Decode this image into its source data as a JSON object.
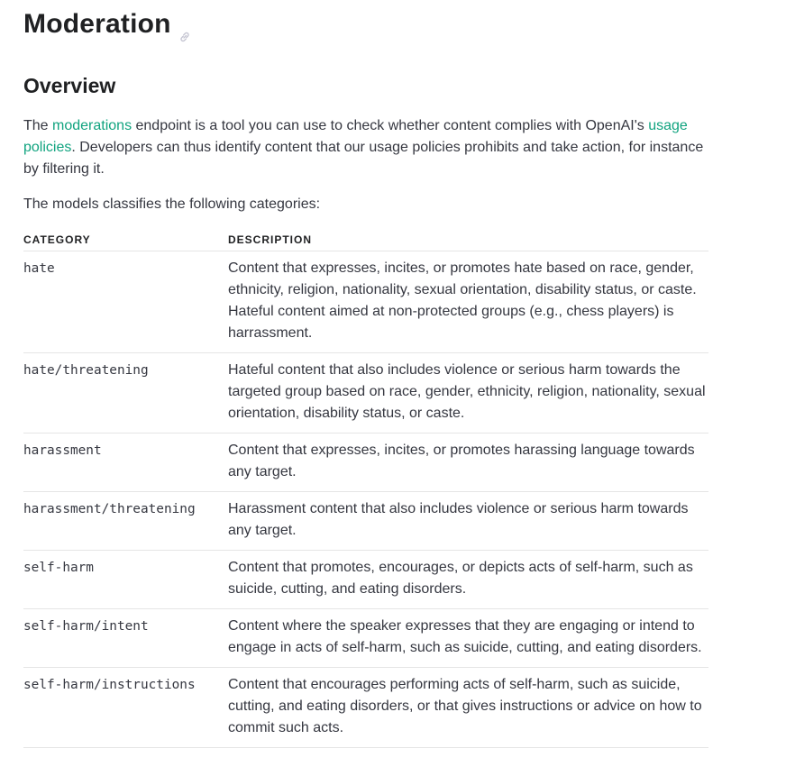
{
  "heading": {
    "title": "Moderation",
    "anchor_icon": "link-icon"
  },
  "overview": {
    "heading": "Overview",
    "intro_prefix": "The ",
    "moderations_link": "moderations",
    "intro_middle": " endpoint is a tool you can use to check whether content complies with OpenAI's ",
    "usage_link": "usage policies",
    "intro_suffix": ". Developers can thus identify content that our usage policies prohibits and take action, for instance by filtering it.",
    "lead": "The models classifies the following categories:"
  },
  "colors": {
    "link": "#10a37f",
    "text": "#353740",
    "heading": "#202123",
    "rule": "#e5e5e5"
  },
  "table": {
    "headers": {
      "category": "CATEGORY",
      "description": "DESCRIPTION"
    },
    "rows": [
      {
        "category": "hate",
        "description": "Content that expresses, incites, or promotes hate based on race, gender, ethnicity, religion, nationality, sexual orientation, disability status, or caste. Hateful content aimed at non-protected groups (e.g., chess players) is harrassment."
      },
      {
        "category": "hate/threatening",
        "description": "Hateful content that also includes violence or serious harm towards the targeted group based on race, gender, ethnicity, religion, nationality, sexual orientation, disability status, or caste."
      },
      {
        "category": "harassment",
        "description": "Content that expresses, incites, or promotes harassing language towards any target."
      },
      {
        "category": "harassment/threatening",
        "description": "Harassment content that also includes violence or serious harm towards any target."
      },
      {
        "category": "self-harm",
        "description": "Content that promotes, encourages, or depicts acts of self-harm, such as suicide, cutting, and eating disorders."
      },
      {
        "category": "self-harm/intent",
        "description": "Content where the speaker expresses that they are engaging or intend to engage in acts of self-harm, such as suicide, cutting, and eating disorders."
      },
      {
        "category": "self-harm/instructions",
        "description": "Content that encourages performing acts of self-harm, such as suicide, cutting, and eating disorders, or that gives instructions or advice on how to commit such acts."
      }
    ]
  }
}
